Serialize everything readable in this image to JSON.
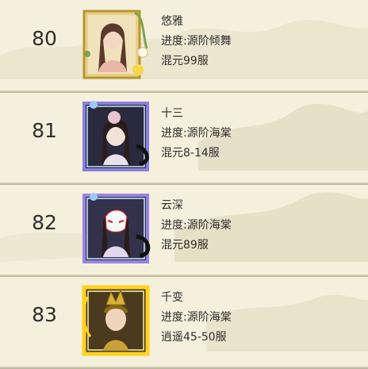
{
  "players": [
    {
      "rank": "80",
      "name": "悠雅",
      "progress": "进度:源阶倾舞",
      "server": "混元99服",
      "frame_style": "gold",
      "avatar": "female-portrait-icon"
    },
    {
      "rank": "81",
      "name": "十三",
      "progress": "进度:源阶海棠",
      "server": "混元8-14服",
      "frame_style": "purple-blue",
      "avatar": "female-portrait-icon"
    },
    {
      "rank": "82",
      "name": "云深",
      "progress": "进度:源阶海棠",
      "server": "混元89服",
      "frame_style": "purple-blue",
      "avatar": "masked-portrait-icon"
    },
    {
      "rank": "83",
      "name": "千变",
      "progress": "进度:源阶海棠",
      "server": "逍遥45-50服",
      "frame_style": "golden-flame",
      "avatar": "crowned-portrait-icon"
    }
  ]
}
